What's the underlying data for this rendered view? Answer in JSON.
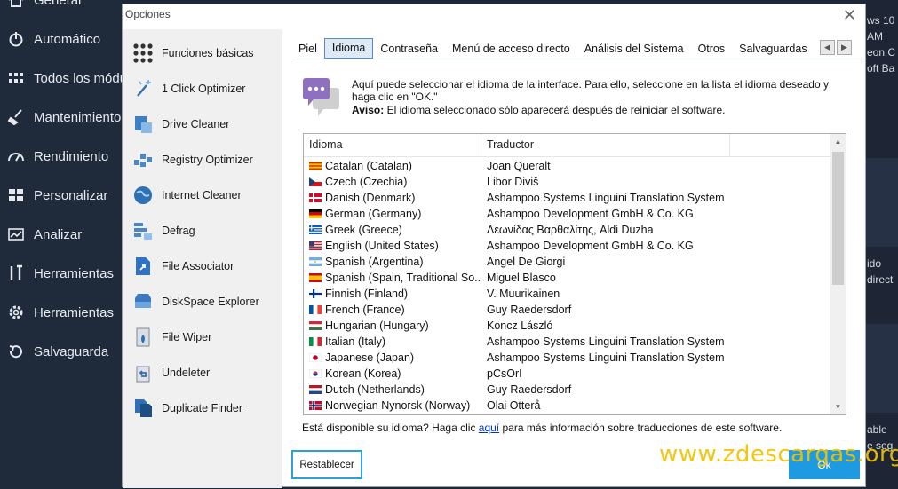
{
  "background": {
    "nav_items": [
      {
        "label": "General",
        "icon": "home-icon"
      },
      {
        "label": "Automático",
        "icon": "power-icon"
      },
      {
        "label": "Todos los módulos",
        "icon": "grid-icon"
      },
      {
        "label": "Mantenimiento",
        "icon": "broom-icon"
      },
      {
        "label": "Rendimiento",
        "icon": "gauge-icon"
      },
      {
        "label": "Personalizar",
        "icon": "windows-icon"
      },
      {
        "label": "Analizar",
        "icon": "chart-icon"
      },
      {
        "label": "Herramientas",
        "icon": "tools-icon"
      },
      {
        "label": "Herramientas",
        "icon": "gear-icon"
      },
      {
        "label": "Salvaguarda",
        "icon": "restore-icon"
      }
    ],
    "right_texts": [
      "ws 10",
      "AM",
      "eon C",
      "oft Ba",
      "ido",
      "direct",
      "able",
      "e seg"
    ]
  },
  "dialog": {
    "title": "Opciones",
    "close_glyph": "✕",
    "left_menu": [
      {
        "label": "Funciones básicas",
        "icon": "dots-grid-icon"
      },
      {
        "label": "1 Click Optimizer",
        "icon": "wand-icon"
      },
      {
        "label": "Drive Cleaner",
        "icon": "drive-cleaner-icon"
      },
      {
        "label": "Registry Optimizer",
        "icon": "registry-icon"
      },
      {
        "label": "Internet Cleaner",
        "icon": "globe-icon"
      },
      {
        "label": "Defrag",
        "icon": "defrag-icon"
      },
      {
        "label": "File Associator",
        "icon": "file-associator-icon"
      },
      {
        "label": "DiskSpace Explorer",
        "icon": "disk-icon"
      },
      {
        "label": "File Wiper",
        "icon": "file-wiper-icon"
      },
      {
        "label": "Undeleter",
        "icon": "undeleter-icon"
      },
      {
        "label": "Duplicate Finder",
        "icon": "duplicate-icon"
      }
    ],
    "tabs": [
      "Piel",
      "Idioma",
      "Contraseña",
      "Menú de acceso directo",
      "Análisis del Sistema",
      "Otros",
      "Salvaguardas"
    ],
    "active_tab": "Idioma",
    "info_line1": "Aquí puede seleccionar el idioma de la interface. Para ello, seleccione en la lista el idioma deseado y haga clic en  \"OK.\"",
    "warn_label": "Aviso:",
    "warn_text": " El idioma seleccionado sólo aparecerá después de reiniciar el software.",
    "columns": [
      "Idioma",
      "Traductor"
    ],
    "languages": [
      {
        "lang": "Catalan (Catalan)",
        "translator": "Joan Queralt",
        "flag": "catalan"
      },
      {
        "lang": "Czech (Czechia)",
        "translator": "Libor Diviš",
        "flag": "czech"
      },
      {
        "lang": "Danish (Denmark)",
        "translator": "Ashampoo Systems Linguini Translation System",
        "flag": "danish"
      },
      {
        "lang": "German (Germany)",
        "translator": "Ashampoo Development GmbH & Co. KG",
        "flag": "german"
      },
      {
        "lang": "Greek (Greece)",
        "translator": "Λεωνίδας Βαρθαλίτης, Aldi Duzha",
        "flag": "greek"
      },
      {
        "lang": "English (United States)",
        "translator": "Ashampoo Development GmbH & Co. KG",
        "flag": "us"
      },
      {
        "lang": "Spanish (Argentina)",
        "translator": "Angel De Giorgi",
        "flag": "argentina"
      },
      {
        "lang": "Spanish (Spain, Traditional So...",
        "translator": "Miguel Blasco",
        "flag": "spain"
      },
      {
        "lang": "Finnish (Finland)",
        "translator": "V. Muurikainen",
        "flag": "finland"
      },
      {
        "lang": "French (France)",
        "translator": "Guy Raedersdorf",
        "flag": "france"
      },
      {
        "lang": "Hungarian (Hungary)",
        "translator": "Koncz László",
        "flag": "hungary"
      },
      {
        "lang": "Italian (Italy)",
        "translator": "Ashampoo Systems Linguini Translation System",
        "flag": "italy"
      },
      {
        "lang": "Japanese (Japan)",
        "translator": "Ashampoo Systems Linguini Translation System",
        "flag": "japan"
      },
      {
        "lang": "Korean (Korea)",
        "translator": "pCsOrI",
        "flag": "korea"
      },
      {
        "lang": "Dutch (Netherlands)",
        "translator": "Guy Raedersdorf",
        "flag": "netherlands"
      },
      {
        "lang": "Norwegian Nynorsk (Norway)",
        "translator": "Olai Otterå",
        "flag": "norway"
      }
    ],
    "footnote_before": "Está disponible su idioma? Haga clic ",
    "footnote_link": "aquí",
    "footnote_after": " para más información sobre traducciones de este software.",
    "reset_label": "Restablecer",
    "ok_label": "Ok"
  },
  "watermark": "www.zdescargas.org",
  "colors": {
    "accent": "#1e9be0",
    "tab_active_border": "#5a8cc4",
    "watermark": "#f2c200"
  }
}
